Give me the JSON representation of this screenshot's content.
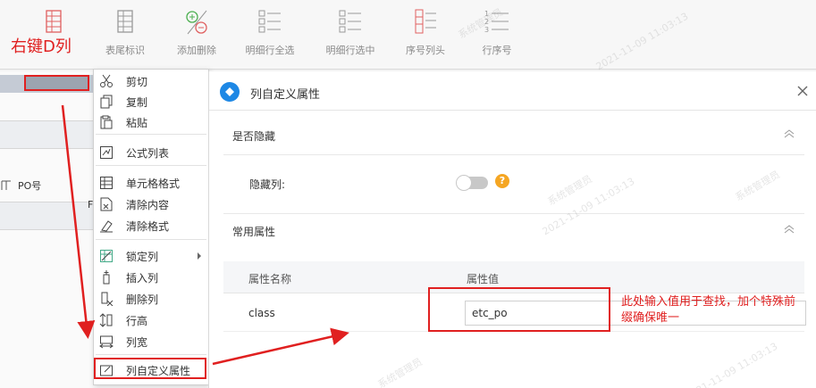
{
  "toolbar": {
    "buttons": [
      {
        "label": "",
        "icon": "footer-row-icon"
      },
      {
        "label": "表尾标识",
        "icon": "footer-mark-icon"
      },
      {
        "label": "添加删除",
        "icon": "add-remove-icon"
      },
      {
        "label": "明细行全选",
        "icon": "select-all-icon"
      },
      {
        "label": "明细行选中",
        "icon": "select-row-icon"
      },
      {
        "label": "序号列头",
        "icon": "index-header-icon"
      },
      {
        "label": "行序号",
        "icon": "row-number-icon"
      }
    ]
  },
  "annotations": {
    "title": "右键D列",
    "note": "此处输入值用于查找，加个特殊前缀确保唯一"
  },
  "sheet": {
    "f_char": "F",
    "po_label": "PO号"
  },
  "context_menu": {
    "items": [
      {
        "label": "剪切",
        "icon": "scissors-icon"
      },
      {
        "label": "复制",
        "icon": "copy-icon"
      },
      {
        "label": "粘贴",
        "icon": "paste-icon"
      },
      {
        "label": "公式列表",
        "icon": "formula-icon"
      },
      {
        "label": "单元格格式",
        "icon": "cell-format-icon"
      },
      {
        "label": "清除内容",
        "icon": "clear-content-icon"
      },
      {
        "label": "清除格式",
        "icon": "clear-format-icon"
      },
      {
        "label": "锁定列",
        "icon": "lock-column-icon"
      },
      {
        "label": "插入列",
        "icon": "insert-column-icon"
      },
      {
        "label": "删除列",
        "icon": "delete-column-icon"
      },
      {
        "label": "行高",
        "icon": "row-height-icon"
      },
      {
        "label": "列宽",
        "icon": "column-width-icon"
      },
      {
        "label": "列自定义属性",
        "icon": "custom-attr-icon"
      }
    ]
  },
  "dialog": {
    "title": "列自定义属性",
    "section_hidden": "是否隐藏",
    "hide_label": "隐藏列:",
    "hide_column": false,
    "section_common": "常用属性",
    "table": {
      "col_name": "属性名称",
      "col_value": "属性值",
      "rows": [
        {
          "name": "class",
          "value": "etc_po"
        }
      ]
    }
  },
  "watermark": {
    "text1": "系统管理员",
    "text2": "2021-11-09 11:03:13"
  },
  "colors": {
    "annotation": "#e02020",
    "toggle_off": "#c8c8c8",
    "help": "#f5a623",
    "logo": "#1e88e5"
  }
}
